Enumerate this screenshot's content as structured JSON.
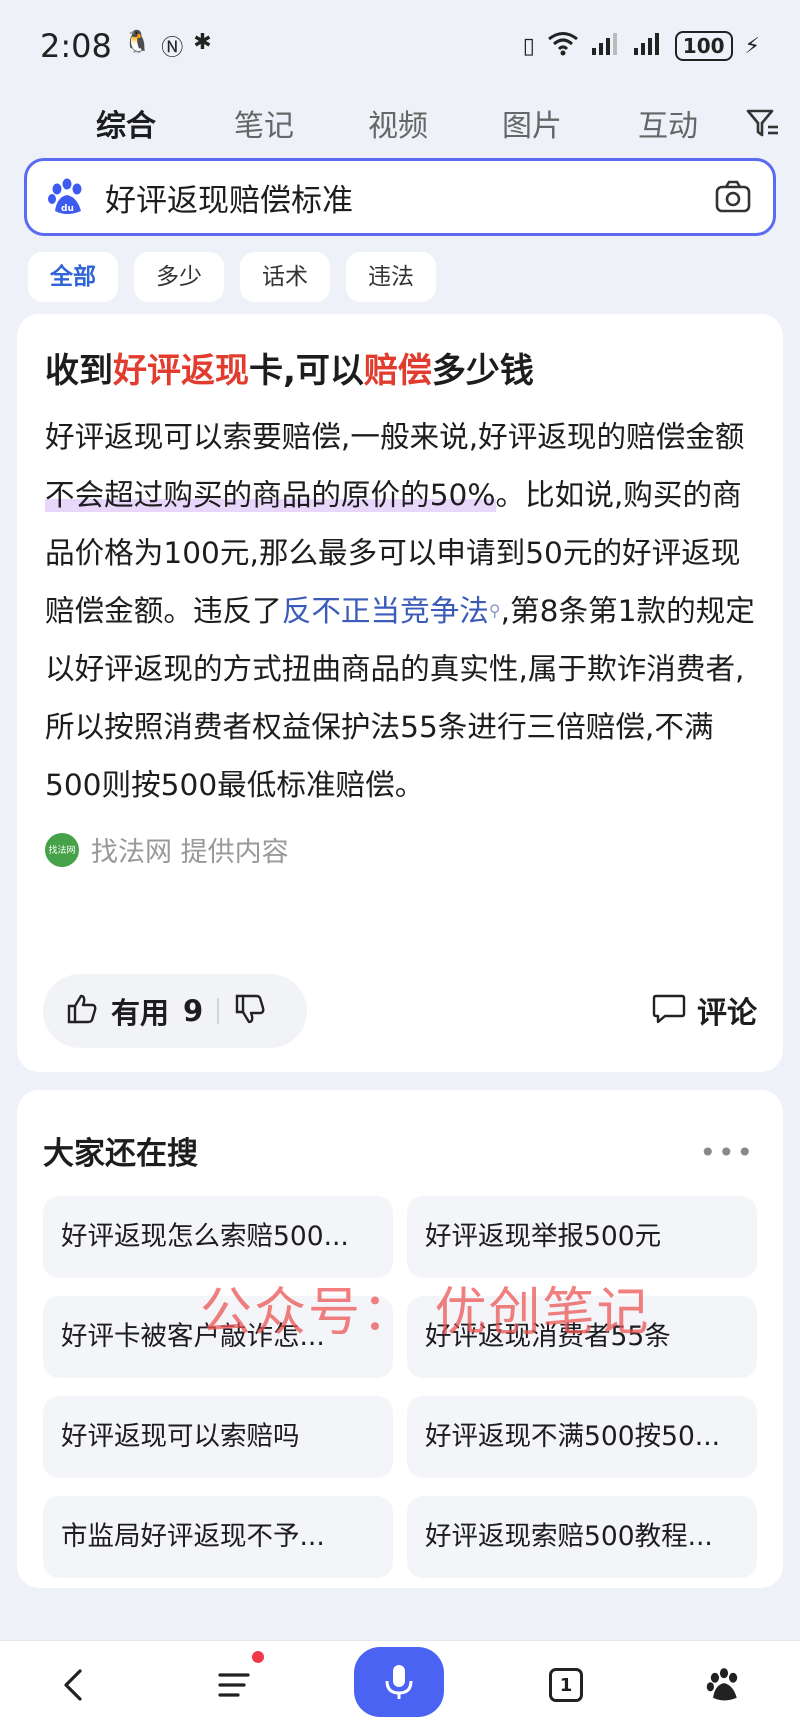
{
  "status_bar": {
    "time": "2:08",
    "battery": "100"
  },
  "tabs": [
    {
      "label": "综合",
      "active": true
    },
    {
      "label": "笔记",
      "active": false
    },
    {
      "label": "视频",
      "active": false
    },
    {
      "label": "图片",
      "active": false
    },
    {
      "label": "互动",
      "active": false
    }
  ],
  "search": {
    "query": "好评返现赔偿标准"
  },
  "chips": [
    "全部",
    "多少",
    "话术",
    "违法"
  ],
  "answer_card": {
    "title_parts": [
      "收到",
      "好评返现",
      "卡,可以",
      "赔偿",
      "多少钱"
    ],
    "body": {
      "p1": "好评返现可以索要赔偿,一般来说,好评返现的赔偿金额",
      "highlight": "不会超过购买的商品的原价的50%",
      "p2": "。比如说,购买的商品价格为100元,那么最多可以申请到50元的好评返现赔偿金额。违反了",
      "link": "反不正当竞争法",
      "p3": ",第8条第1款的规定以好评返现的方式扭曲商品的真实性,属于欺诈消费者,所以按照消费者权益保护法55条进行三倍赔偿,不满500则按500最低标准赔偿。"
    },
    "source_logo_text": "找法网",
    "source": "找法网  提供内容",
    "useful_label": "有用",
    "useful_count": "9",
    "comment_label": "评论"
  },
  "related": {
    "title": "大家还在搜",
    "items": [
      "好评返现怎么索赔500...",
      "好评返现举报500元",
      "好评卡被客户敲诈怎...",
      "好评返现消费者55条",
      "好评返现可以索赔吗",
      "好评返现不满500按50...",
      "市监局好评返现不予...",
      "好评返现索赔500教程..."
    ]
  },
  "watermark": "公众号：  优创笔记",
  "bottom_nav": {
    "tab_count": "1"
  },
  "colors": {
    "accent": "#4b63f3",
    "highlight_red": "#e23c2f",
    "link_blue": "#3a5bb8"
  }
}
